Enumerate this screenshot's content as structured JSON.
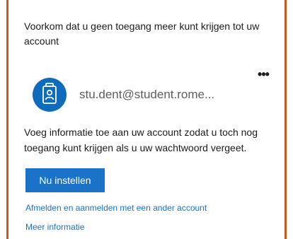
{
  "prompt": {
    "heading": "Voorkom dat u geen toegang meer kunt krijgen tot uw account",
    "account": {
      "email": "stu.dent@student.rome...",
      "more_label": "•••",
      "avatar_icon": "id-badge-icon"
    },
    "info": "Voeg informatie toe aan uw account zodat u toch nog toegang kunt krijgen als u uw wachtwoord vergeet.",
    "primary_button": "Nu instellen",
    "links": {
      "switch_account": "Afmelden en aanmelden met een ander account",
      "more_info": "Meer informatie"
    }
  },
  "colors": {
    "border": "#c25a1a",
    "accent": "#1a73c8",
    "avatar_bg": "#0f6cbd"
  }
}
